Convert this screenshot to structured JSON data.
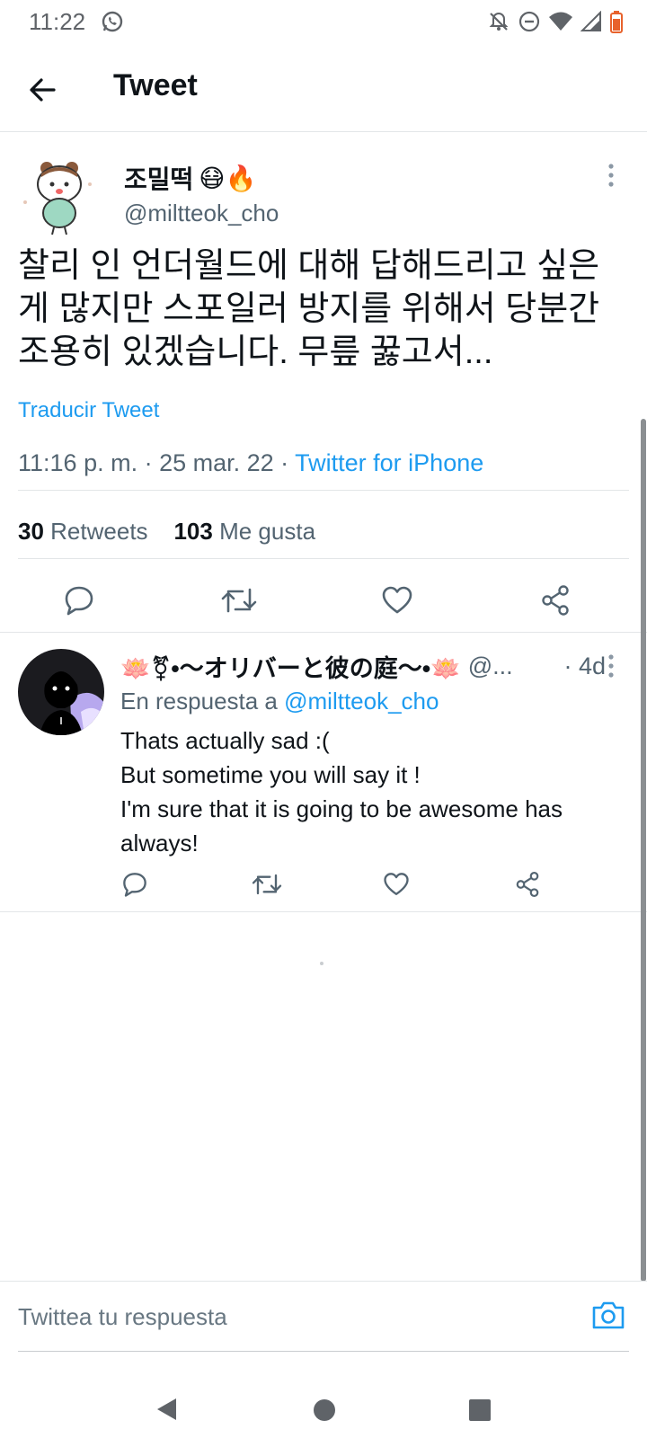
{
  "status_bar": {
    "time": "11:22"
  },
  "header": {
    "title": "Tweet"
  },
  "tweet": {
    "author_name": "조밀떡",
    "author_emojis": "😷🔥",
    "author_handle": "@miltteok_cho",
    "text": "찰리 인 언더월드에 대해 답해드리고 싶은 게 많지만 스포일러 방지를 위해서 당분간 조용히 있겠습니다. 무릎 꿇고서...",
    "translate_label": "Traducir Tweet",
    "meta_time": "11:16 p. m. · 25 mar. 22 · ",
    "meta_source": "Twitter for iPhone",
    "retweets_count": "30",
    "retweets_label": "Retweets",
    "likes_count": "103",
    "likes_label": "Me gusta"
  },
  "reply": {
    "name": "🪷⚧•〜オリバーと彼の庭〜•🪷",
    "handle": "@...",
    "time": "· 4d",
    "reply_to_prefix": "En respuesta a ",
    "reply_to_handle": "@miltteok_cho",
    "lines": [
      "Thats actually sad :(",
      "But sometime you will say it !",
      "I'm sure that it is going to be awesome has always!"
    ]
  },
  "compose": {
    "placeholder": "Twittea tu respuesta"
  },
  "colors": {
    "accent": "#1d9bf0",
    "text": "#0f1419",
    "secondary": "#536471"
  }
}
